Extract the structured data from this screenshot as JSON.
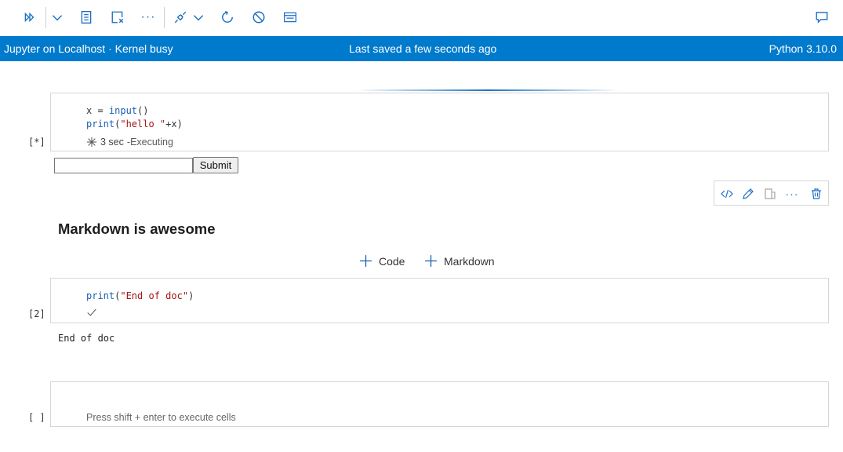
{
  "toolbar": {
    "run_all_icon": "run-all-icon",
    "chevron_icon": "chevron-down-icon",
    "variables_icon": "variables-icon",
    "clear_outputs_icon": "clear-outputs-icon",
    "more_label": "···",
    "kernel_icon": "kernel-connect-icon",
    "restart_icon": "restart-icon",
    "interrupt_icon": "interrupt-icon",
    "outline_icon": "outline-icon",
    "comment_icon": "comment-icon"
  },
  "statusbar": {
    "left": "Jupyter on Localhost · Kernel busy",
    "center": "Last saved a few seconds ago",
    "right": "Python 3.10.0"
  },
  "cells": [
    {
      "exec_count": "[*]",
      "code_lines": [
        "x = input()",
        "print(\"hello \"+x)"
      ],
      "status_time": "3 sec",
      "status_sep": " - ",
      "status_text": "Executing"
    },
    {
      "exec_count": "[2]",
      "code_lines": [
        "print(\"End of doc\")"
      ],
      "output": "End of doc"
    },
    {
      "exec_count": "[ ]",
      "placeholder": "Press shift + enter to execute cells"
    }
  ],
  "input_widget": {
    "value": "",
    "submit_label": "Submit"
  },
  "markdown": {
    "heading": "Markdown is awesome"
  },
  "add_cell": {
    "code_label": "Code",
    "markdown_label": "Markdown"
  },
  "colors": {
    "accent": "#007acc",
    "icon": "#1a6fc4"
  }
}
